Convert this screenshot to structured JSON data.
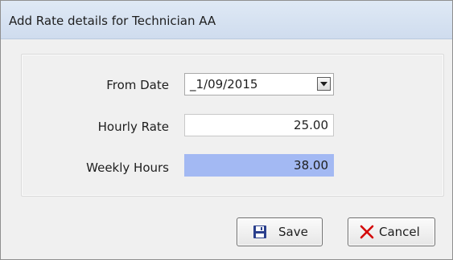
{
  "window": {
    "title": "Add Rate details for Technician AA"
  },
  "form": {
    "from_date": {
      "label": "From Date",
      "value": "_1/09/2015"
    },
    "hourly_rate": {
      "label": "Hourly Rate",
      "value": "25.00"
    },
    "weekly_hours": {
      "label": "Weekly Hours",
      "value": "38.00"
    }
  },
  "buttons": {
    "save": {
      "label": "Save",
      "icon": "floppy-disk-icon"
    },
    "cancel": {
      "label": "Cancel",
      "icon": "red-x-icon"
    }
  },
  "colors": {
    "highlight_field": "#a3b9f3",
    "save_icon": "#2a3f8c",
    "cancel_icon": "#d40000"
  }
}
